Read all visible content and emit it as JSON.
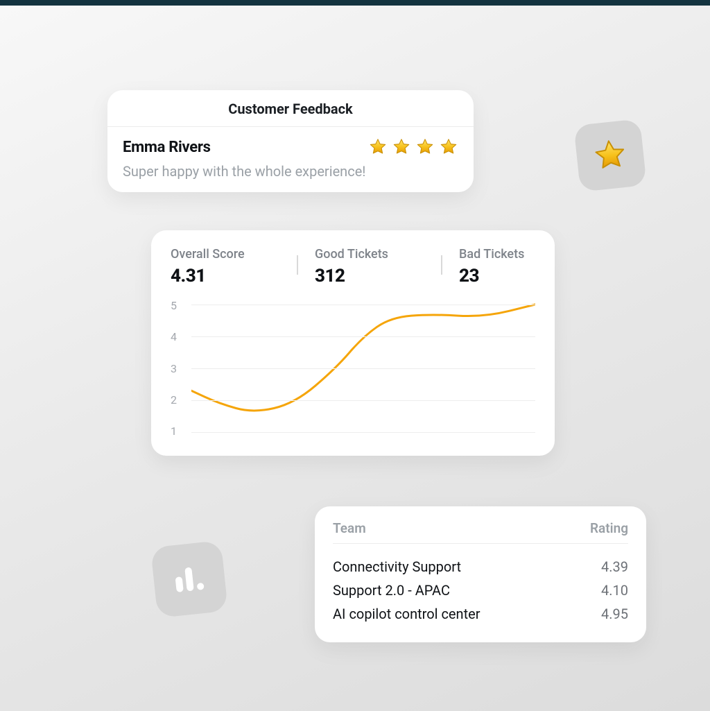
{
  "colors": {
    "accent": "#f5a50a",
    "star_fill": "#f7c21c",
    "star_stroke": "#c88f04"
  },
  "feedback": {
    "title": "Customer Feedback",
    "name": "Emma Rivers",
    "stars": 4,
    "text": "Super happy with the whole experience!"
  },
  "metrics": {
    "overall": {
      "label": "Overall Score",
      "value": "4.31"
    },
    "good": {
      "label": "Good  Tickets",
      "value": "312"
    },
    "bad": {
      "label": "Bad Tickets",
      "value": "23"
    }
  },
  "chart_data": {
    "type": "line",
    "title": "",
    "xlabel": "",
    "ylabel": "",
    "ylim": [
      1,
      5
    ],
    "yticks": [
      5,
      4,
      3,
      2,
      1
    ],
    "x": [
      0,
      0.08,
      0.18,
      0.3,
      0.42,
      0.5,
      0.58,
      0.7,
      0.85,
      1.0
    ],
    "values": [
      2.3,
      1.9,
      1.6,
      1.9,
      3.0,
      4.0,
      4.6,
      4.7,
      4.6,
      5.0
    ]
  },
  "teams": {
    "headers": {
      "team": "Team",
      "rating": "Rating"
    },
    "rows": [
      {
        "name": "Connectivity Support",
        "rating": "4.39"
      },
      {
        "name": "Support 2.0 - APAC",
        "rating": "4.10"
      },
      {
        "name": "AI copilot control center",
        "rating": "4.95"
      }
    ]
  },
  "icons": {
    "star_badge": "star-icon",
    "bars_badge": "bar-chart-icon"
  }
}
